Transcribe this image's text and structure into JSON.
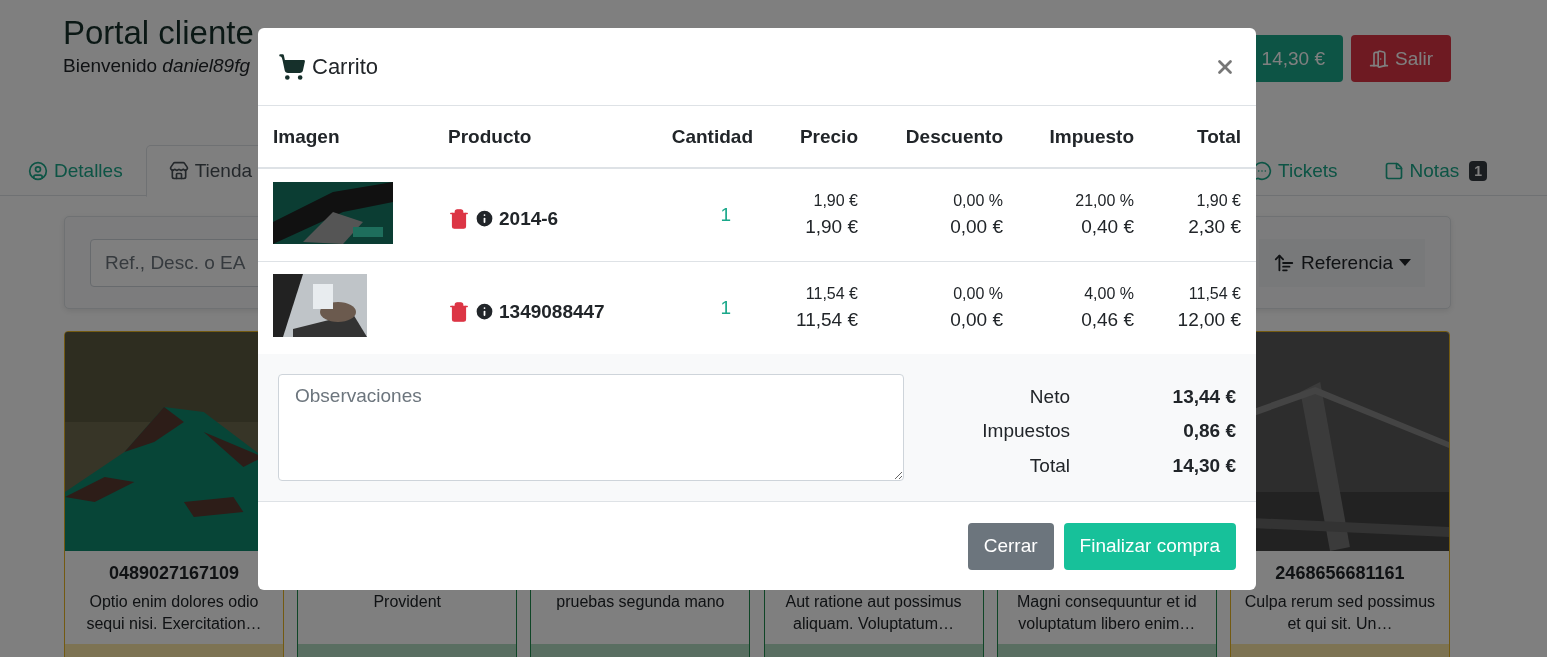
{
  "header": {
    "title": "Portal cliente",
    "greeting": "Bienvenido",
    "username": "daniel89fg"
  },
  "top_buttons": [
    {
      "kind": "cart",
      "label": "14,30 €"
    },
    {
      "kind": "logout",
      "label": "Salir"
    }
  ],
  "tabs_left": [
    {
      "label": "Detalles",
      "selected": false
    },
    {
      "label": "Tienda",
      "selected": true
    }
  ],
  "tabs_right": [
    {
      "label": "Tickets",
      "selected": false
    },
    {
      "label": "Notas",
      "selected": false,
      "badge": "1"
    }
  ],
  "search": {
    "placeholder": "Ref., Desc. o EA"
  },
  "sort": {
    "label": "Referencia"
  },
  "products": [
    {
      "title": "0489027167109",
      "description": "Optio enim dolores odio sequi nisi. Exercitation…",
      "kind": "warning"
    },
    {
      "description": "Provident",
      "kind": "success"
    },
    {
      "description": "pruebas segunda mano",
      "kind": "success"
    },
    {
      "description": "Aut ratione aut possimus aliquam. Voluptatum…",
      "kind": "success"
    },
    {
      "description": "Magni consequuntur et id voluptatum libero enim…",
      "kind": "success"
    },
    {
      "title": "2468656681161",
      "description": "Culpa rerum sed possimus et qui sit. Un…",
      "kind": "warning"
    }
  ],
  "cart": {
    "title": "Carrito",
    "columns": [
      "Imagen",
      "Producto",
      "Cantidad",
      "Precio",
      "Descuento",
      "Impuesto",
      "Total"
    ],
    "rows": [
      {
        "product": "2014-6",
        "quantity": "1",
        "price_base": "1,90 €",
        "price": "1,90 €",
        "discount_rate": "0,00 %",
        "discount": "0,00 €",
        "tax_rate": "21,00 %",
        "tax": "0,40 €",
        "subtotal": "1,90 €",
        "total": "2,30 €"
      },
      {
        "product": "1349088447",
        "quantity": "1",
        "price_base": "11,54 €",
        "price": "11,54 €",
        "discount_rate": "0,00 %",
        "discount": "0,00 €",
        "tax_rate": "4,00 %",
        "tax": "0,46 €",
        "subtotal": "11,54 €",
        "total": "12,00 €"
      }
    ],
    "notes": {
      "placeholder": "Observaciones"
    },
    "summary": [
      {
        "label": "Neto",
        "value": "13,44 €"
      },
      {
        "label": "Impuestos",
        "value": "0,86 €"
      },
      {
        "label": "Total",
        "value": "14,30 €"
      }
    ],
    "buttons": [
      {
        "kind": "secondary",
        "label": "Cerrar"
      },
      {
        "kind": "primary",
        "label": "Finalizar compra"
      }
    ]
  }
}
